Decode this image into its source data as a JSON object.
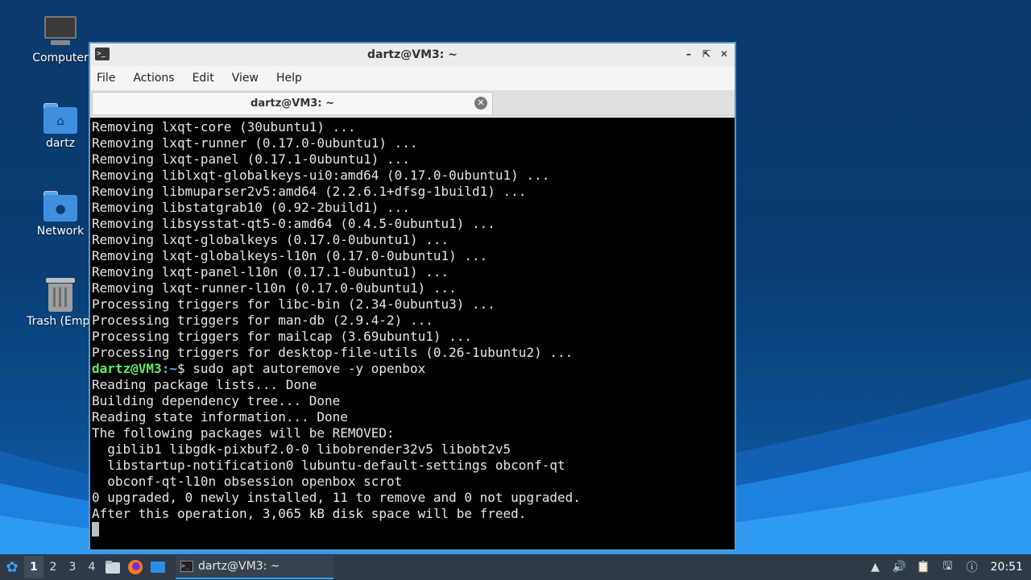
{
  "desktop": {
    "icons": [
      {
        "label": "Computer"
      },
      {
        "label": "dartz"
      },
      {
        "label": "Network"
      },
      {
        "label": "Trash (Empt"
      }
    ]
  },
  "window": {
    "title": "dartz@VM3: ~",
    "menu": [
      "File",
      "Actions",
      "Edit",
      "View",
      "Help"
    ],
    "tab_title": "dartz@VM3: ~"
  },
  "terminal": {
    "lines": [
      "Removing lxqt-core (30ubuntu1) ...",
      "Removing lxqt-runner (0.17.0-0ubuntu1) ...",
      "Removing lxqt-panel (0.17.1-0ubuntu1) ...",
      "Removing liblxqt-globalkeys-ui0:amd64 (0.17.0-0ubuntu1) ...",
      "Removing libmuparser2v5:amd64 (2.2.6.1+dfsg-1build1) ...",
      "Removing libstatgrab10 (0.92-2build1) ...",
      "Removing libsysstat-qt5-0:amd64 (0.4.5-0ubuntu1) ...",
      "Removing lxqt-globalkeys (0.17.0-0ubuntu1) ...",
      "Removing lxqt-globalkeys-l10n (0.17.0-0ubuntu1) ...",
      "Removing lxqt-panel-l10n (0.17.1-0ubuntu1) ...",
      "Removing lxqt-runner-l10n (0.17.0-0ubuntu1) ...",
      "Processing triggers for libc-bin (2.34-0ubuntu3) ...",
      "Processing triggers for man-db (2.9.4-2) ...",
      "Processing triggers for mailcap (3.69ubuntu1) ...",
      "Processing triggers for desktop-file-utils (0.26-1ubuntu2) ..."
    ],
    "prompt_user": "dartz@VM3",
    "prompt_path": ":~",
    "prompt_symbol": "$ ",
    "command": "sudo apt autoremove -y openbox",
    "output": [
      "Reading package lists... Done",
      "Building dependency tree... Done",
      "Reading state information... Done",
      "The following packages will be REMOVED:",
      "  giblib1 libgdk-pixbuf2.0-0 libobrender32v5 libobt2v5",
      "  libstartup-notification0 lubuntu-default-settings obconf-qt",
      "  obconf-qt-l10n obsession openbox scrot",
      "0 upgraded, 0 newly installed, 11 to remove and 0 not upgraded.",
      "After this operation, 3,065 kB disk space will be freed."
    ]
  },
  "taskbar": {
    "workspaces": [
      "1",
      "2",
      "3",
      "4"
    ],
    "active_workspace": "1",
    "task_label": "dartz@VM3: ~",
    "clock": "20:51"
  },
  "colors": {
    "accent": "#3aa0ff",
    "prompt_user": "#5fef5f",
    "prompt_path": "#5fa8ff"
  }
}
